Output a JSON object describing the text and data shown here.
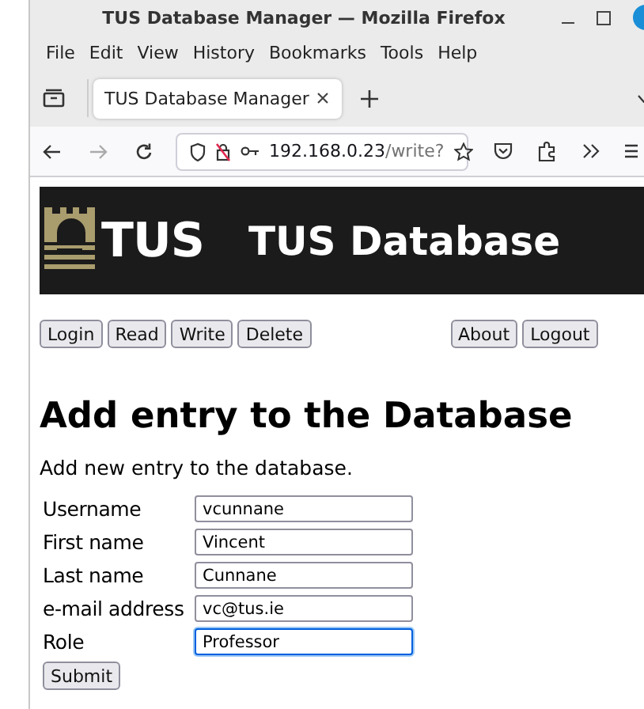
{
  "window": {
    "title": "TUS Database Manager — Mozilla Firefox"
  },
  "menu": [
    "File",
    "Edit",
    "View",
    "History",
    "Bookmarks",
    "Tools",
    "Help"
  ],
  "tabs": [
    {
      "label": "TUS Database Manager",
      "selected": true
    }
  ],
  "address_bar": {
    "host": "192.168.0.23",
    "path": "/write?"
  },
  "site": {
    "logo_text": "TUS",
    "title": "TUS Database"
  },
  "nav_buttons_left": [
    "Login",
    "Read",
    "Write",
    "Delete"
  ],
  "nav_buttons_right": [
    "About",
    "Logout"
  ],
  "heading": "Add entry to the Database",
  "intro": "Add new entry to the database.",
  "fields": [
    {
      "label": "Username",
      "value": "vcunnane",
      "focused": false
    },
    {
      "label": "First name",
      "value": "Vincent",
      "focused": false
    },
    {
      "label": "Last name",
      "value": "Cunnane",
      "focused": false
    },
    {
      "label": "e-mail address",
      "value": "vc@tus.ie",
      "focused": false
    },
    {
      "label": "Role",
      "value": "Professor",
      "focused": true
    }
  ],
  "submit": "Submit"
}
